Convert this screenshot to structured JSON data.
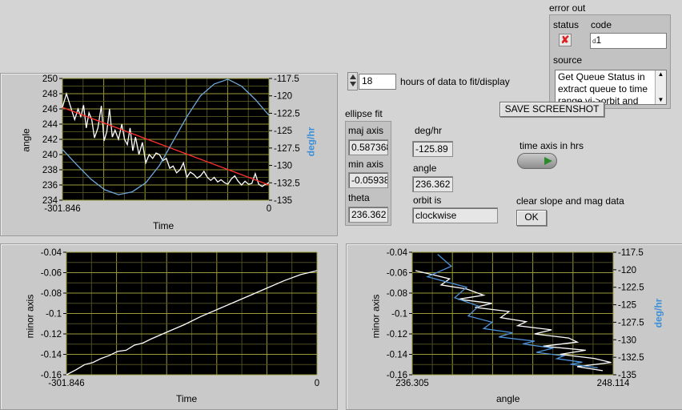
{
  "error_out": {
    "title": "error out",
    "status_label": "status",
    "code_label": "code",
    "code_value": "1",
    "code_prefix": "d",
    "source_label": "source",
    "source_text": "Get Queue Status in extract queue to time range.vi->orbit and"
  },
  "controls": {
    "hours_value": "18",
    "hours_label": "hours of data to fit/display",
    "save_screenshot": "SAVE SCREENSHOT",
    "time_axis_label": "time axis in hrs",
    "clear_label": "clear slope and mag data",
    "ok_label": "OK"
  },
  "ellipse": {
    "title": "ellipse fit",
    "maj_label": "maj axis",
    "maj_value": "0.587368",
    "min_label": "min axis",
    "min_value": "-0.05938",
    "theta_label": "theta",
    "theta_value": "236.362",
    "deghr_label": "deg/hr",
    "deghr_value": "-125.89",
    "angle_label": "angle",
    "angle_value": "236.362",
    "orbit_label": "orbit is",
    "orbit_value": "clockwise"
  },
  "chart_data": [
    {
      "type": "line",
      "title": "",
      "xlabel": "Time",
      "ylabel": "angle",
      "y2label": "deg/hr",
      "xlim": [
        -301.846,
        0
      ],
      "ylim": [
        234,
        250
      ],
      "y2lim": [
        -135,
        -117.5
      ],
      "x_ticks": [
        "-301.846",
        "0"
      ],
      "y_ticks": [
        "250",
        "248",
        "246",
        "244",
        "242",
        "240",
        "238",
        "236",
        "234"
      ],
      "y2_ticks": [
        "-117.5",
        "-120",
        "-122.5",
        "-125",
        "-127.5",
        "-130",
        "-132.5",
        "-135"
      ],
      "series": [
        {
          "axis": "left",
          "color": "#ffffff",
          "x": [
            -301.8,
            -296,
            -290,
            -284,
            -279,
            -275,
            -271,
            -267,
            -263,
            -259,
            -255,
            -250,
            -245,
            -241,
            -237,
            -233,
            -229,
            -225,
            -220,
            -215,
            -211,
            -207,
            -203,
            -199,
            -195,
            -190,
            -185,
            -180,
            -175,
            -170,
            -165,
            -160,
            -155,
            -150,
            -145,
            -140,
            -135,
            -130,
            -125,
            -120,
            -115,
            -110,
            -105,
            -100,
            -95,
            -90,
            -85,
            -80,
            -75,
            -70,
            -65,
            -60,
            -55,
            -50,
            -45,
            -40,
            -35,
            -30,
            -25,
            -20,
            -15,
            -10,
            -5,
            0
          ],
          "y": [
            246.2,
            248.0,
            246.3,
            244.6,
            246.0,
            245.0,
            246.5,
            243.5,
            245.5,
            244.6,
            242.2,
            243.5,
            246.4,
            241.8,
            243.0,
            246.0,
            242.3,
            243.2,
            242.0,
            244.0,
            242.0,
            241.3,
            243.5,
            240.5,
            242.3,
            240.0,
            241.6,
            238.9,
            240.0,
            239.5,
            240.2,
            240.0,
            239.2,
            239.5,
            238.2,
            238.5,
            237.6,
            238.0,
            238.9,
            237.0,
            237.7,
            237.4,
            236.9,
            237.2,
            237.8,
            237.0,
            236.6,
            237.0,
            236.4,
            236.7,
            236.3,
            236.1,
            236.8,
            237.2,
            236.5,
            236.0,
            236.5,
            236.1,
            236.2,
            237.5,
            236.1,
            235.8,
            236.1,
            236.3
          ]
        },
        {
          "axis": "left",
          "color": "#ff3030",
          "x": [
            -301.8,
            0
          ],
          "y": [
            246.2,
            236.0
          ]
        },
        {
          "axis": "right",
          "color": "#6fa8dc",
          "x": [
            -301.8,
            -280,
            -260,
            -240,
            -220,
            -200,
            -180,
            -160,
            -140,
            -120,
            -100,
            -80,
            -60,
            -40,
            -20,
            0
          ],
          "y": [
            -127.7,
            -130.0,
            -132.0,
            -133.5,
            -134.2,
            -133.8,
            -132.5,
            -130.0,
            -126.5,
            -123.0,
            -120.0,
            -118.3,
            -117.6,
            -118.6,
            -120.5,
            -122.8
          ]
        }
      ]
    },
    {
      "type": "line",
      "title": "",
      "xlabel": "Time",
      "ylabel": "minor axis",
      "xlim": [
        -301.846,
        0
      ],
      "ylim": [
        -0.16,
        -0.04
      ],
      "x_ticks": [
        "-301.846",
        "0"
      ],
      "y_ticks": [
        "-0.04",
        "-0.06",
        "-0.08",
        "-0.1",
        "-0.12",
        "-0.14",
        "-0.16"
      ],
      "series": [
        {
          "color": "#ffffff",
          "x": [
            -301.8,
            -290,
            -280,
            -270,
            -260,
            -250,
            -240,
            -230,
            -220,
            -210,
            -200,
            -180,
            -160,
            -140,
            -120,
            -100,
            -80,
            -60,
            -40,
            -20,
            0
          ],
          "y": [
            -0.16,
            -0.155,
            -0.15,
            -0.148,
            -0.144,
            -0.141,
            -0.137,
            -0.136,
            -0.131,
            -0.129,
            -0.125,
            -0.118,
            -0.111,
            -0.103,
            -0.096,
            -0.089,
            -0.082,
            -0.075,
            -0.068,
            -0.062,
            -0.058
          ]
        }
      ]
    },
    {
      "type": "scatter",
      "title": "",
      "xlabel": "angle",
      "ylabel": "minor axis",
      "y2label": "deg/hr",
      "xlim": [
        236.305,
        248.114
      ],
      "ylim": [
        -0.16,
        -0.04
      ],
      "y2lim": [
        -135,
        -117.5
      ],
      "x_ticks": [
        "236.305",
        "248.114"
      ],
      "y_ticks": [
        "-0.04",
        "-0.06",
        "-0.08",
        "-0.1",
        "-0.12",
        "-0.14",
        "-0.16"
      ],
      "y2_ticks": [
        "-117.5",
        "-120",
        "-122.5",
        "-125",
        "-127.5",
        "-130",
        "-132.5",
        "-135"
      ],
      "series": [
        {
          "axis": "left",
          "color": "#ffffff",
          "x": [
            236.5,
            237.5,
            238.5,
            238.0,
            239.5,
            240.5,
            239.0,
            241.0,
            240.0,
            242.0,
            241.5,
            243.0,
            242.5,
            244.5,
            243.5,
            245.5,
            246.0,
            244.0,
            246.5,
            245.0,
            247.0,
            248.0,
            246.0,
            247.5
          ],
          "y": [
            -0.058,
            -0.062,
            -0.066,
            -0.072,
            -0.076,
            -0.082,
            -0.086,
            -0.09,
            -0.094,
            -0.098,
            -0.104,
            -0.108,
            -0.112,
            -0.116,
            -0.12,
            -0.124,
            -0.128,
            -0.132,
            -0.136,
            -0.14,
            -0.144,
            -0.148,
            -0.152,
            -0.156
          ]
        },
        {
          "axis": "right",
          "color": "#4f93d8",
          "x": [
            237.8,
            238.6,
            237.2,
            239.5,
            238.8,
            240.2,
            239.6,
            241.0,
            240.5,
            242.2,
            241.4,
            243.5,
            242.8,
            244.6,
            243.6,
            245.2,
            244.8,
            246.3,
            245.6,
            247.2
          ],
          "y": [
            -117.8,
            -119.5,
            -121.0,
            -122.5,
            -124.0,
            -125.2,
            -126.6,
            -127.5,
            -128.4,
            -129.0,
            -129.6,
            -130.2,
            -130.6,
            -131.2,
            -131.8,
            -132.3,
            -132.7,
            -133.2,
            -133.5,
            -134.0
          ]
        }
      ]
    }
  ]
}
